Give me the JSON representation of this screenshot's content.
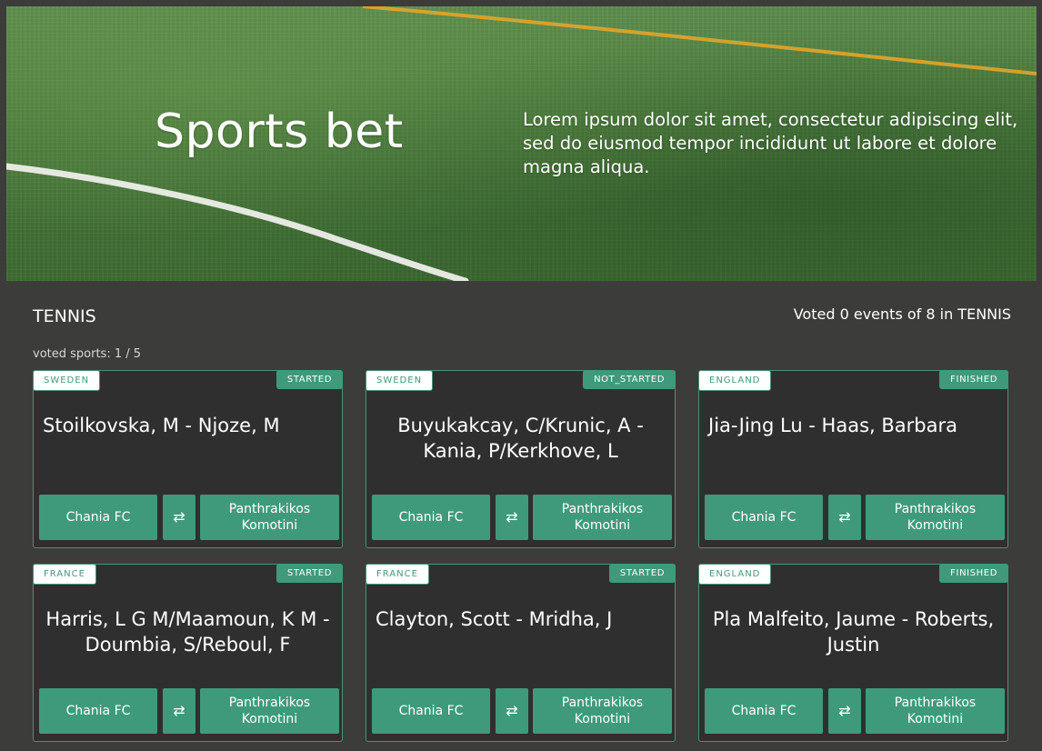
{
  "hero": {
    "title": "Sports bet",
    "description": "Lorem ipsum dolor sit amet, consectetur adipiscing elit, sed do eiusmod tempor incididunt ut labore et dolore magna aliqua."
  },
  "section": {
    "title": "TENNIS",
    "voted_events": "Voted 0 events of 8 in TENNIS",
    "voted_sports": "voted sports: 1 / 5"
  },
  "cards": [
    {
      "region": "SWEDEN",
      "status": "STARTED",
      "match": "Stoilkovska, M - Njoze, M",
      "home": "Chania FC",
      "swap_icon": "⇄",
      "away": "Panthrakikos Komotini"
    },
    {
      "region": "SWEDEN",
      "status": "NOT_STARTED",
      "match": "Buyukakcay, C/Krunic, A - Kania, P/Kerkhove, L",
      "home": "Chania FC",
      "swap_icon": "⇄",
      "away": "Panthrakikos Komotini"
    },
    {
      "region": "ENGLAND",
      "status": "FINISHED",
      "match": "Jia-Jing Lu - Haas, Barbara",
      "home": "Chania FC",
      "swap_icon": "⇄",
      "away": "Panthrakikos Komotini"
    },
    {
      "region": "FRANCE",
      "status": "STARTED",
      "match": "Harris, L G M/Maamoun, K M - Doumbia, S/Reboul, F",
      "home": "Chania FC",
      "swap_icon": "⇄",
      "away": "Panthrakikos Komotini"
    },
    {
      "region": "FRANCE",
      "status": "STARTED",
      "match": "Clayton, Scott - Mridha, J",
      "home": "Chania FC",
      "swap_icon": "⇄",
      "away": "Panthrakikos Komotini"
    },
    {
      "region": "ENGLAND",
      "status": "FINISHED",
      "match": "Pla Malfeito, Jaume - Roberts, Justin",
      "home": "Chania FC",
      "swap_icon": "⇄",
      "away": "Panthrakikos Komotini"
    }
  ],
  "colors": {
    "background": "#3c3c3b",
    "card_background": "#2f2f2f",
    "accent": "#3f9a7c",
    "field_line_white": "#f2f2ee",
    "field_line_yellow": "#e2a52a"
  }
}
